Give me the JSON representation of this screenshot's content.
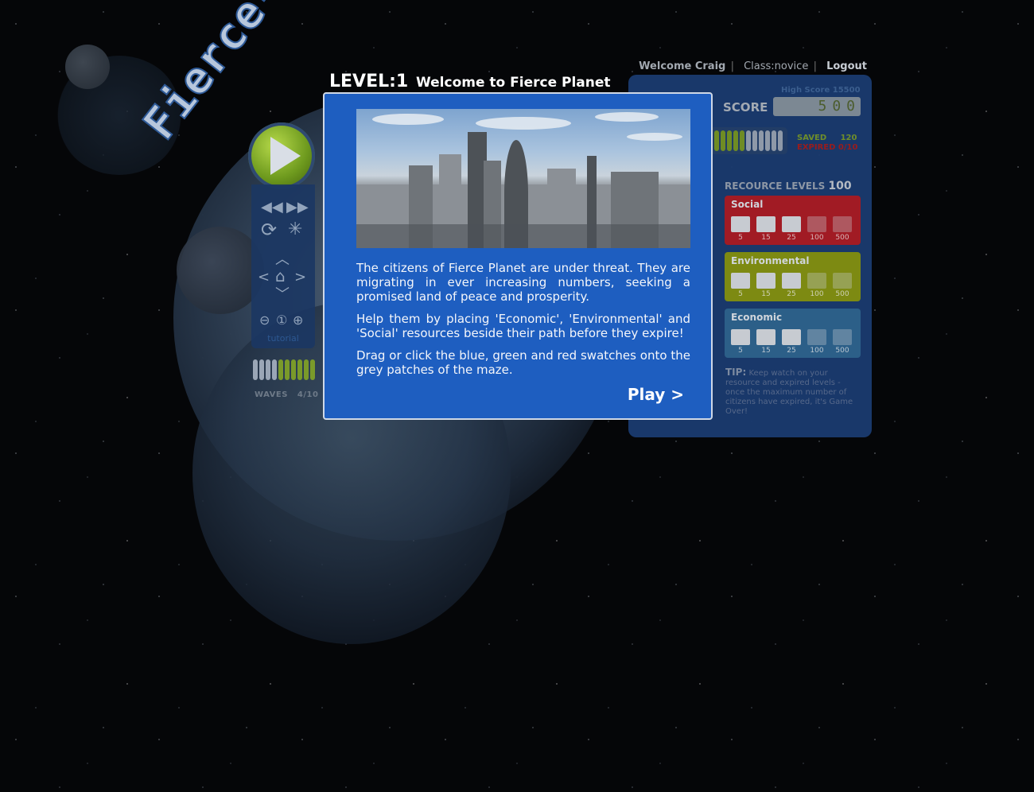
{
  "app": {
    "logo_text": "Fierce-Planet"
  },
  "topbar": {
    "welcome": "Welcome Craig",
    "class_label": "Class:novice",
    "logout": "Logout"
  },
  "controls": {
    "tutorial_label": "tutorial",
    "waves_label": "WAVES",
    "waves_value": "4/10"
  },
  "score": {
    "high_score_label": "High Score 15500",
    "label": "SCORE",
    "value": "500"
  },
  "status": {
    "saved_label": "SAVED",
    "saved_value": "120",
    "expired_label": "EXPIRED",
    "expired_value": "0/10"
  },
  "resources": {
    "title": "RECOURCE LEVELS",
    "value": "100",
    "groups": [
      {
        "name": "Social",
        "levels": [
          "5",
          "15",
          "25",
          "100",
          "500"
        ]
      },
      {
        "name": "Environmental",
        "levels": [
          "5",
          "15",
          "25",
          "100",
          "500"
        ]
      },
      {
        "name": "Economic",
        "levels": [
          "5",
          "15",
          "25",
          "100",
          "500"
        ]
      }
    ],
    "colors": {
      "social": "#a11b24",
      "environmental": "#7d8a12",
      "economic": "#2c5f88"
    }
  },
  "tip": {
    "label": "TIP:",
    "text": "Keep watch on your resource and expired levels - once the maximum number of citizens have expired, it's Game Over!"
  },
  "dialog": {
    "level": "LEVEL:1",
    "title": "Welcome to Fierce Planet",
    "paragraphs": [
      "The citizens of Fierce Planet are under threat. They are migrating in ever increasing numbers, seeking a promised land of peace and prosperity.",
      "Help them by placing 'Economic', 'Environmental' and 'Social' resources beside their path before they expire!",
      "Drag or click the blue, green and red swatches onto the grey patches of the maze."
    ],
    "play_label": "Play >"
  }
}
